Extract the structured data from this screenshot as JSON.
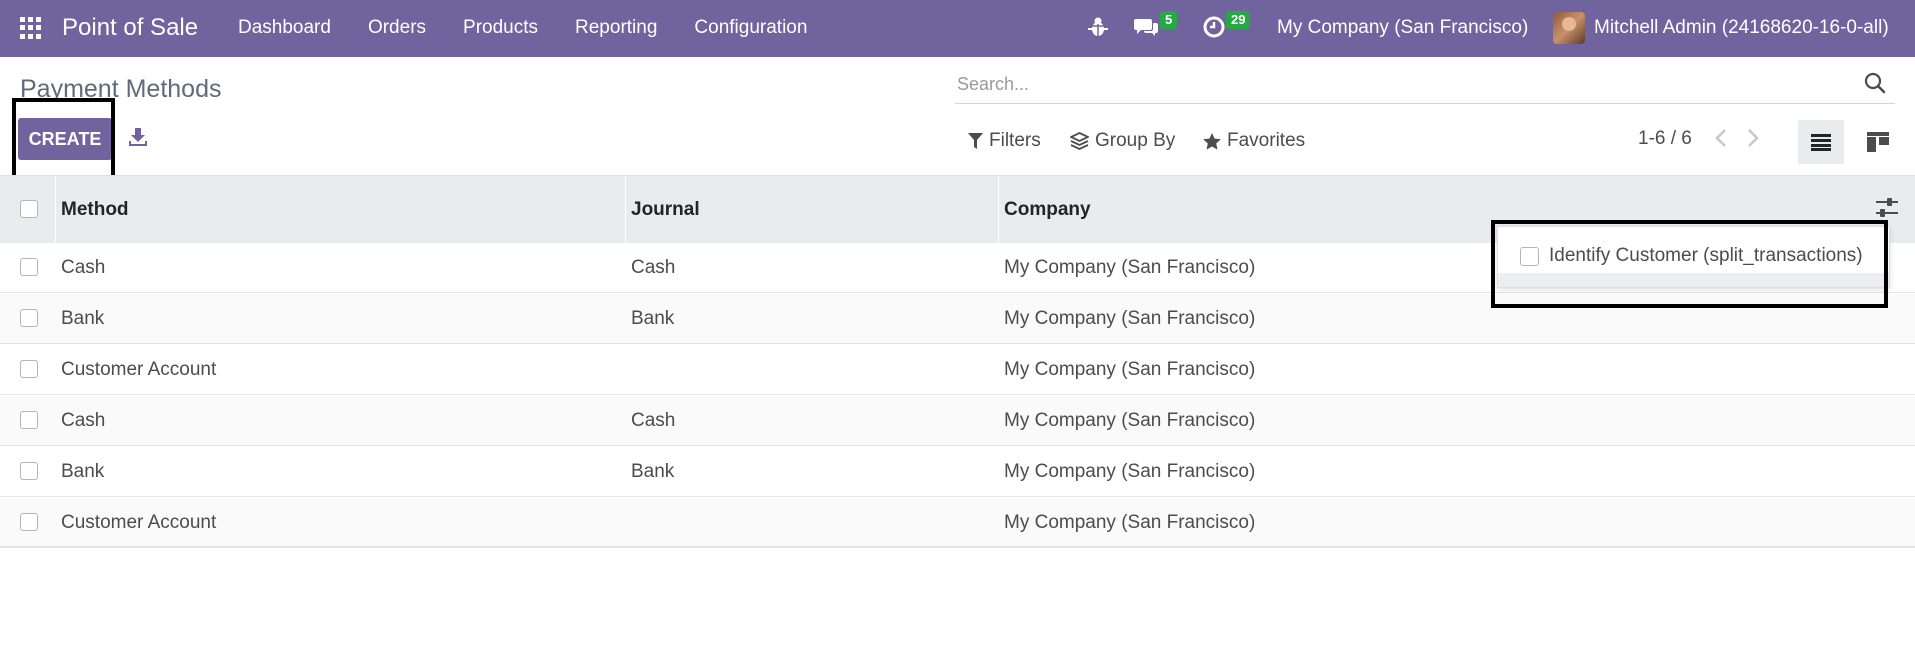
{
  "navbar": {
    "app_name": "Point of Sale",
    "menu": [
      "Dashboard",
      "Orders",
      "Products",
      "Reporting",
      "Configuration"
    ],
    "messages_count": "5",
    "activities_count": "29",
    "company": "My Company (San Francisco)",
    "user": "Mitchell Admin (24168620-16-0-all)",
    "accent_color": "#71639e"
  },
  "control_panel": {
    "title": "Payment Methods",
    "create_label": "CREATE",
    "search_placeholder": "Search...",
    "filters_label": "Filters",
    "group_by_label": "Group By",
    "favorites_label": "Favorites",
    "pager": "1-6 / 6"
  },
  "table": {
    "columns": [
      "Method",
      "Journal",
      "Company"
    ],
    "rows": [
      {
        "method": "Cash",
        "journal": "Cash",
        "company": "My Company (San Francisco)"
      },
      {
        "method": "Bank",
        "journal": "Bank",
        "company": "My Company (San Francisco)"
      },
      {
        "method": "Customer Account",
        "journal": "",
        "company": "My Company (San Francisco)"
      },
      {
        "method": "Cash",
        "journal": "Cash",
        "company": "My Company (San Francisco)"
      },
      {
        "method": "Bank",
        "journal": "Bank",
        "company": "My Company (San Francisco)"
      },
      {
        "method": "Customer Account",
        "journal": "",
        "company": "My Company (San Francisco)"
      }
    ]
  },
  "optional_columns": {
    "items": [
      {
        "label": "Identify Customer (split_transactions)",
        "checked": false
      }
    ]
  }
}
